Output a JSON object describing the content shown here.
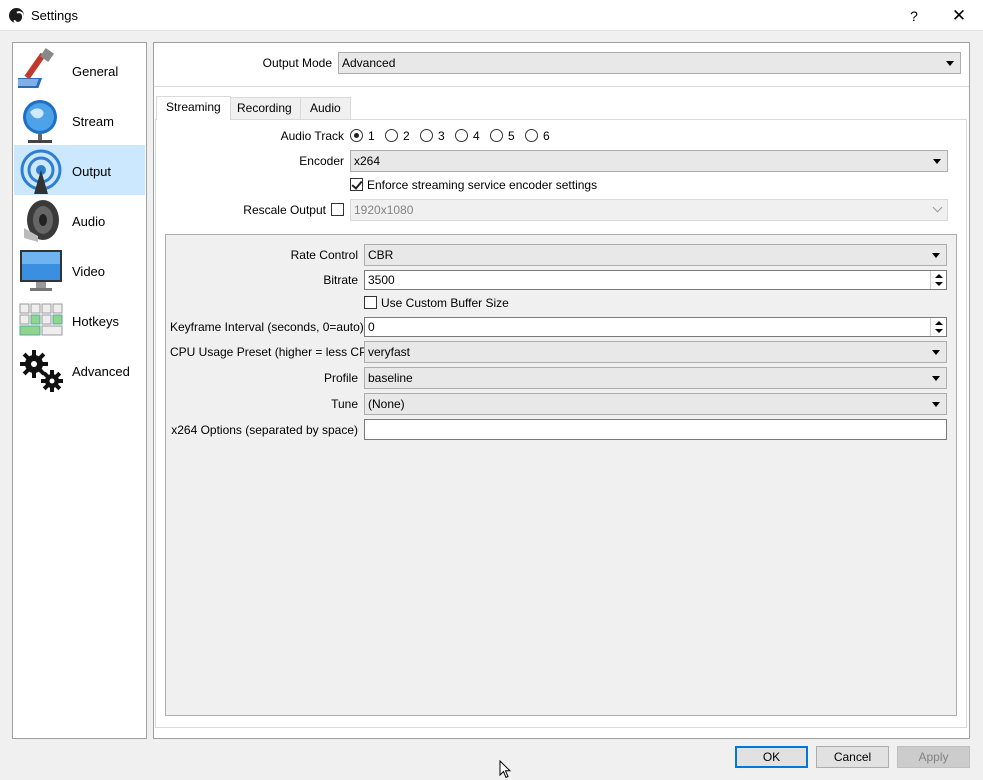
{
  "window": {
    "title": "Settings",
    "help": "?",
    "close": "✕"
  },
  "sidebar": {
    "items": [
      {
        "label": "General",
        "icon": "general-icon"
      },
      {
        "label": "Stream",
        "icon": "stream-globe-icon"
      },
      {
        "label": "Output",
        "icon": "output-antenna-icon",
        "selected": true
      },
      {
        "label": "Audio",
        "icon": "speaker-icon"
      },
      {
        "label": "Video",
        "icon": "monitor-icon"
      },
      {
        "label": "Hotkeys",
        "icon": "keyboard-icon"
      },
      {
        "label": "Advanced",
        "icon": "gears-icon"
      }
    ]
  },
  "output_mode": {
    "label": "Output Mode",
    "value": "Advanced"
  },
  "tabs": [
    {
      "label": "Streaming",
      "active": true
    },
    {
      "label": "Recording"
    },
    {
      "label": "Audio"
    }
  ],
  "streaming": {
    "audio_track": {
      "label": "Audio Track",
      "options": [
        "1",
        "2",
        "3",
        "4",
        "5",
        "6"
      ],
      "selected": "1"
    },
    "encoder": {
      "label": "Encoder",
      "value": "x264"
    },
    "enforce": {
      "label": "Enforce streaming service encoder settings",
      "checked": true
    },
    "rescale": {
      "label": "Rescale Output",
      "checked": false,
      "value": "1920x1080"
    },
    "rate_control": {
      "label": "Rate Control",
      "value": "CBR"
    },
    "bitrate": {
      "label": "Bitrate",
      "value": "3500"
    },
    "custom_buffer": {
      "label": "Use Custom Buffer Size",
      "checked": false
    },
    "keyframe": {
      "label": "Keyframe Interval (seconds, 0=auto)",
      "value": "0"
    },
    "cpu_preset": {
      "label": "CPU Usage Preset (higher = less CPU)",
      "value": "veryfast"
    },
    "profile": {
      "label": "Profile",
      "value": "baseline"
    },
    "tune": {
      "label": "Tune",
      "value": "(None)"
    },
    "x264_options": {
      "label": "x264 Options (separated by space)",
      "value": ""
    }
  },
  "buttons": {
    "ok": "OK",
    "cancel": "Cancel",
    "apply": "Apply"
  },
  "colors": {
    "selected_bg": "#cce8ff",
    "default_border": "#0078d7"
  }
}
